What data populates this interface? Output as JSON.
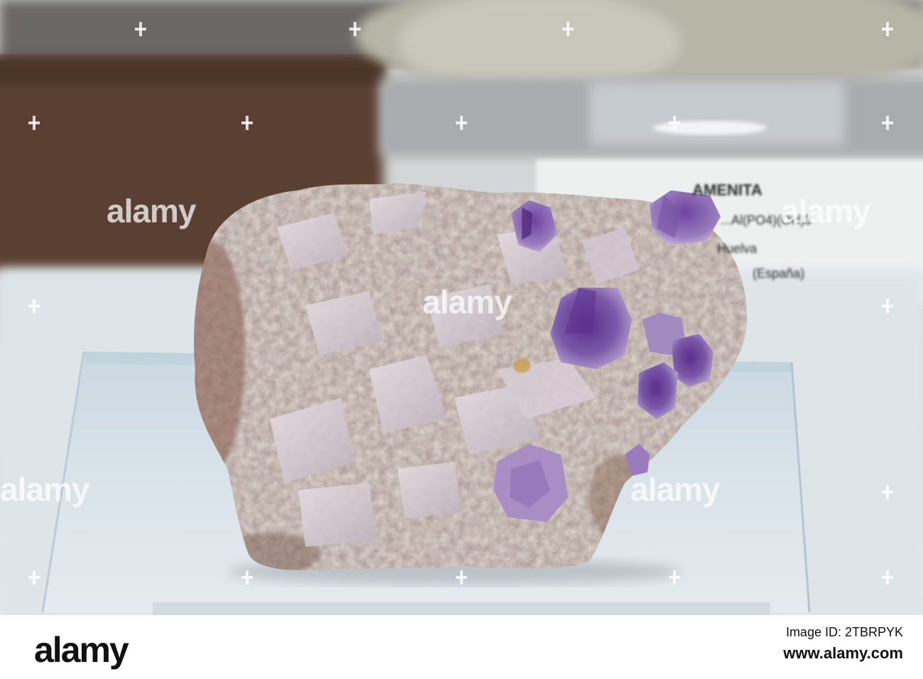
{
  "photo": {
    "subject": "mineral-specimen-amethyst-on-matrix"
  },
  "specimen_label": {
    "line1": "AMENITA",
    "line2": "...Al(PO4)(OH)3",
    "line3": "Huelva",
    "line4": "(España)"
  },
  "watermark": {
    "text": "alamy"
  },
  "footer": {
    "logo": "alamy",
    "image_id_label": "Image ID: 2TBRPYK",
    "url": "www.alamy.com"
  },
  "colors": {
    "background": "#dfe6ea",
    "amethyst": "#6a4a9a",
    "matrix": "#b9a8a6",
    "footer_bg": "#ffffff"
  }
}
